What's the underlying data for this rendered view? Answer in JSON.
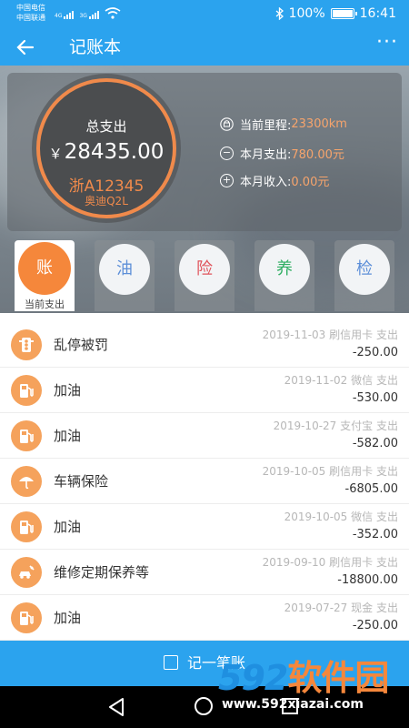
{
  "status_bar": {
    "carrier_1": "中国电信",
    "carrier_2": "中国联通",
    "net_1": "4G",
    "net_2": "3G",
    "battery": "100%",
    "time": "16:41"
  },
  "app_bar": {
    "title": "记账本"
  },
  "summary": {
    "label": "总支出",
    "currency": "￥",
    "total": "28435.00",
    "plate": "浙A12345",
    "model": "奥迪Q2L",
    "mileage_label": "当前里程:",
    "mileage_value": "23300km",
    "monthly_expense_label": "本月支出:",
    "monthly_expense_value": "780.00元",
    "monthly_income_label": "本月收入:",
    "monthly_income_value": "0.00元",
    "accent_color": "#f08a4b"
  },
  "categories": [
    {
      "glyph": "账",
      "label": "当前支出",
      "active": true
    },
    {
      "glyph": "油",
      "color": "#5d8fd8"
    },
    {
      "glyph": "险",
      "color": "#e0535b"
    },
    {
      "glyph": "养",
      "color": "#2fae62"
    },
    {
      "glyph": "检",
      "color": "#5d8fd8"
    }
  ],
  "records": [
    {
      "title": "乱停被罚",
      "date": "2019-11-03",
      "method": "刷信用卡",
      "type": "支出",
      "amount": "-250.00",
      "icon": "traffic-fine-icon"
    },
    {
      "title": "加油",
      "date": "2019-11-02",
      "method": "微信",
      "type": "支出",
      "amount": "-530.00",
      "icon": "fuel-pump-icon"
    },
    {
      "title": "加油",
      "date": "2019-10-27",
      "method": "支付宝",
      "type": "支出",
      "amount": "-582.00",
      "icon": "fuel-pump-icon"
    },
    {
      "title": "车辆保险",
      "date": "2019-10-05",
      "method": "刷信用卡",
      "type": "支出",
      "amount": "-6805.00",
      "icon": "insurance-umbrella-icon"
    },
    {
      "title": "加油",
      "date": "2019-10-05",
      "method": "微信",
      "type": "支出",
      "amount": "-352.00",
      "icon": "fuel-pump-icon"
    },
    {
      "title": "维修定期保养等",
      "date": "2019-09-10",
      "method": "刷信用卡",
      "type": "支出",
      "amount": "-18800.00",
      "icon": "car-repair-icon"
    },
    {
      "title": "加油",
      "date": "2019-07-27",
      "method": "现金",
      "type": "支出",
      "amount": "-250.00",
      "icon": "fuel-pump-icon"
    }
  ],
  "bottom_button": {
    "label": "记一笔账"
  },
  "watermark": {
    "logo_num": "592",
    "logo_text": "软件园",
    "url": "www.592xiazai.com"
  },
  "colors": {
    "primary": "#2ba3ee",
    "orange": "#f5873b"
  }
}
